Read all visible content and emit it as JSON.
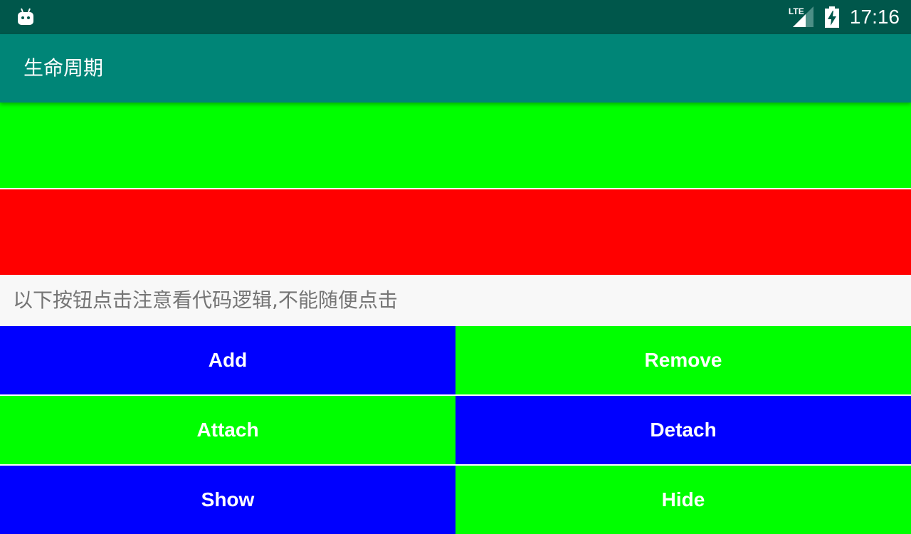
{
  "status_bar": {
    "left_icon": "android-robot-icon",
    "network": "LTE",
    "signal_icon": "cell-signal-icon",
    "battery_icon": "battery-charging-icon",
    "time": "17:16"
  },
  "app_bar": {
    "title": "生命周期"
  },
  "notice": {
    "text": "以下按钮点击注意看代码逻辑,不能随便点击"
  },
  "buttons": {
    "add": "Add",
    "remove": "Remove",
    "attach": "Attach",
    "detach": "Detach",
    "show": "Show",
    "hide": "Hide"
  },
  "colors": {
    "status_bar": "#00574b",
    "app_bar": "#008577",
    "green": "#00ff00",
    "red": "#ff0000",
    "blue": "#0000ff"
  }
}
